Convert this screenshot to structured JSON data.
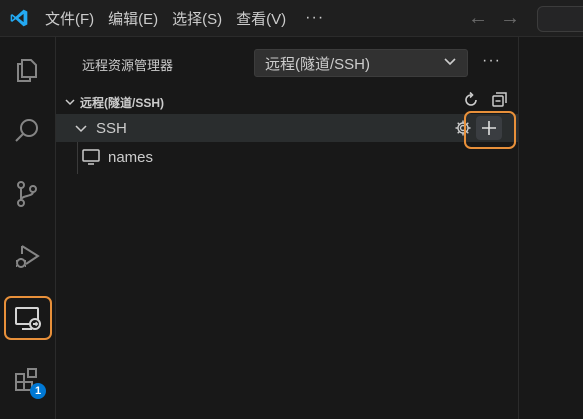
{
  "menu": {
    "items": [
      "文件(F)",
      "编辑(E)",
      "选择(S)",
      "查看(V)"
    ],
    "more": "···"
  },
  "activity_bar": {
    "items": [
      "explorer",
      "search",
      "source-control",
      "run-and-debug",
      "remote-explorer",
      "extensions"
    ],
    "active": "remote-explorer",
    "extensions_badge": "1"
  },
  "sidebar": {
    "title": "远程资源管理器",
    "remote_select": "远程(隧道/SSH)",
    "more": "···",
    "section_title": "远程(隧道/SSH)",
    "ssh_group": "SSH",
    "hosts": [
      {
        "name": "names"
      }
    ]
  },
  "colors": {
    "highlight": "#e8903a",
    "vscode_blue": "#23a9f2",
    "badge": "#0078d4"
  }
}
